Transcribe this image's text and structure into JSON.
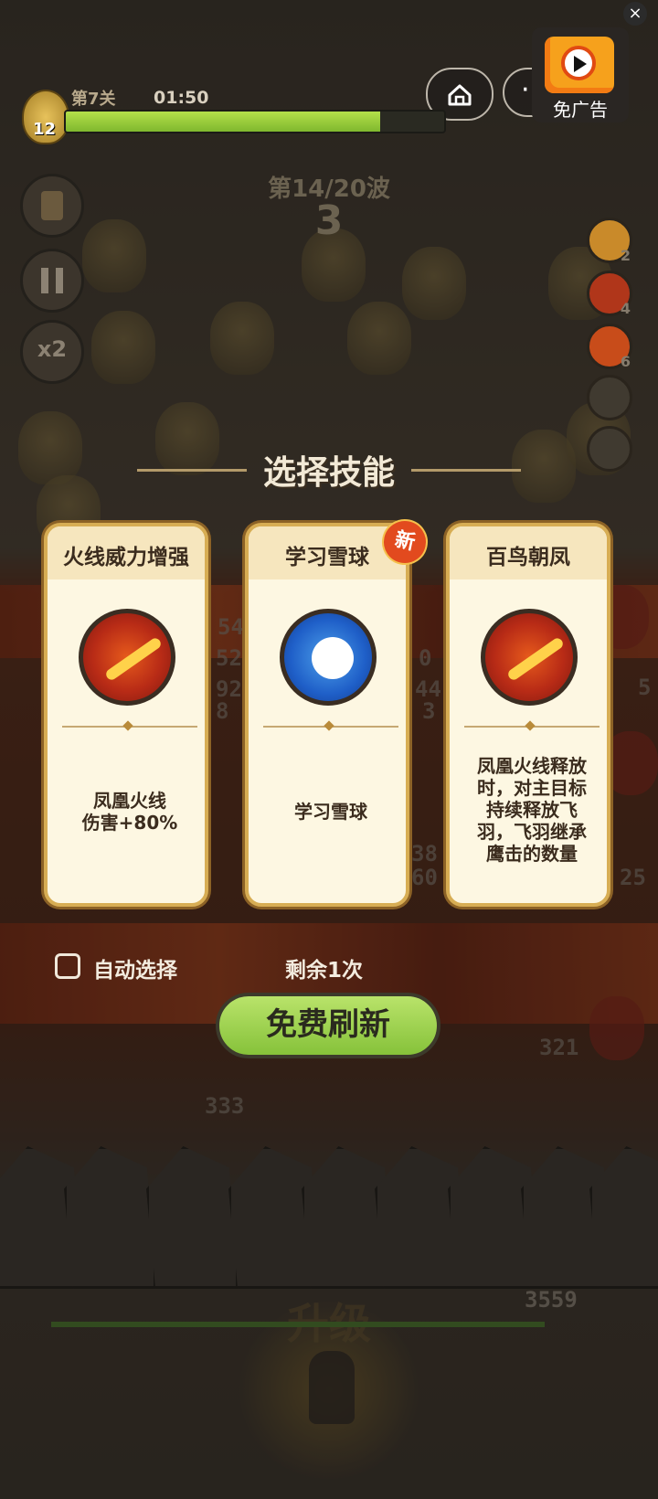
{
  "hud": {
    "close": "×",
    "more": "···",
    "ad_label": "免广告",
    "level_number": "12",
    "stage": "第7关",
    "timer": "01:50",
    "xp_progress": 0.83,
    "wave": "第14/20波",
    "countdown": "3",
    "speed": "x2",
    "skill_counts": [
      "2",
      "4",
      "6"
    ]
  },
  "background": {
    "damage_numbers": [
      "54",
      "52",
      "92",
      "8",
      "0",
      "44",
      "3",
      "5",
      "38",
      "60",
      "25",
      "321",
      "333"
    ],
    "hp_value": "3559",
    "upgrade": "升级"
  },
  "modal": {
    "title": "选择技能",
    "new_badge": "新",
    "cards": [
      {
        "name": "火线威力增强",
        "icon": "fire-streak-icon",
        "desc": [
          "凤凰火线",
          "伤害+80%"
        ]
      },
      {
        "name": "学习雪球",
        "icon": "snowball-icon",
        "desc": [
          "学习雪球"
        ]
      },
      {
        "name": "百鸟朝凤",
        "icon": "fire-streak-icon",
        "desc": [
          "凤凰火线释放",
          "时，对主目标",
          "持续释放飞",
          "羽，飞羽继承",
          "鹰击的数量"
        ]
      }
    ],
    "auto_select": "自动选择",
    "remaining": "剩余1次",
    "refresh_button": "免费刷新"
  },
  "colors": {
    "card_border": "#d7ad54",
    "refresh_green": "#9fd44e",
    "new_badge": "#e24a1e"
  }
}
